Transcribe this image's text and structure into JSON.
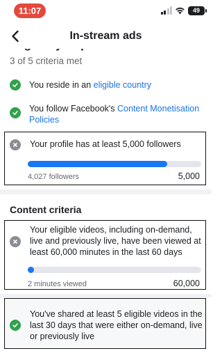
{
  "status": {
    "time": "11:07",
    "battery": "49"
  },
  "header": {
    "title": "In-stream ads",
    "back_icon": "chevron-left-icon",
    "cut_heading": "Eligibility requirements"
  },
  "summary": {
    "criteria_met": "3 of 5 criteria met"
  },
  "criteria": [
    {
      "status": "met",
      "icon": "check-circle-icon",
      "text_prefix": "You reside in an ",
      "link": "eligible country",
      "text_suffix": ""
    },
    {
      "status": "met",
      "icon": "check-circle-icon",
      "text_prefix": "You follow Facebook's ",
      "link": "Content Monetisation Policies",
      "text_suffix": ""
    }
  ],
  "followers": {
    "status": "not-met",
    "icon": "x-circle-icon",
    "text": "Your profile has at least 5,000 followers",
    "current_label": "4,027 followers",
    "target_label": "5,000",
    "progress": 0.8054
  },
  "content_section": {
    "title": "Content criteria"
  },
  "minutes": {
    "status": "not-met",
    "icon": "x-circle-icon",
    "text": "Your eligible videos, including on-demand, live and previously live, have been viewed at least 60,000 minutes in the last 60 days",
    "current_label": "2 minutes viewed",
    "target_label": "60,000",
    "progress": 0.0
  },
  "videos": {
    "status": "met",
    "icon": "check-circle-icon",
    "text": "You've shared at least 5 eligible videos in the last 30 days that were either on-demand, live or previously live"
  },
  "colors": {
    "accent": "#1877f2",
    "link": "#1b74e4",
    "met": "#31a24c",
    "not_met": "#8a8d91",
    "time_pill": "#e5483d"
  }
}
